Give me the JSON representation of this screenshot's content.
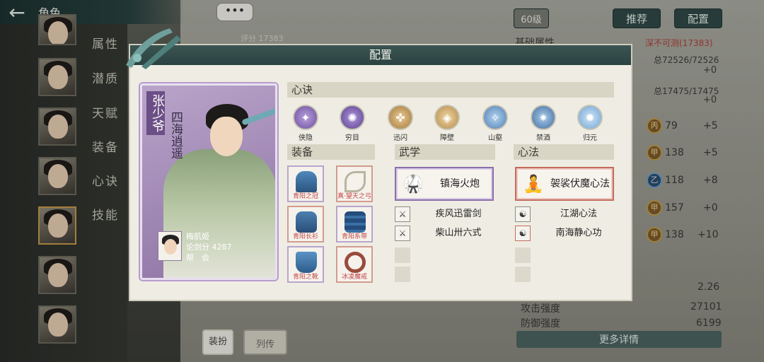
{
  "topbar": {
    "back_icon": "back-arrow-icon",
    "title": "角色"
  },
  "side_tabs": [
    "属性",
    "潜质",
    "天赋",
    "装备",
    "心诀",
    "技能"
  ],
  "top_right": {
    "level": "60级",
    "recommend": "推荐",
    "config": "配置"
  },
  "background": {
    "score": "评分 17383",
    "base_attr_label": "基础属性",
    "base_attr_value": "深不可测(17383)",
    "hp": "总72526/72526",
    "hp_plus": "+0",
    "mp": "总17475/17475",
    "mp_plus": "+0",
    "stats": [
      {
        "gem": "丙",
        "value": "79",
        "plus": "+5"
      },
      {
        "gem": "甲",
        "value": "138",
        "plus": "+5"
      },
      {
        "gem": "乙",
        "value": "118",
        "plus": "+8"
      },
      {
        "gem": "甲",
        "value": "157",
        "plus": "+0"
      },
      {
        "gem": "甲",
        "value": "138",
        "plus": "+10"
      }
    ],
    "misc_value": "2.26",
    "attack_label": "攻击强度",
    "attack_value": "27101",
    "defense_label": "防御强度",
    "defense_value": "6199",
    "more_details": "更多详情",
    "dress_label": "装扮",
    "bio_label": "列传"
  },
  "modal": {
    "title": "配置",
    "character": {
      "name": "张少爷",
      "title": "四海逍遥",
      "owner_name": "梅肌姬",
      "owner_score": "论剑分 4287",
      "owner_guild": "帮　会"
    },
    "sections": {
      "mind": "心诀",
      "equipment": "装备",
      "martial": "武学",
      "heart": "心法"
    },
    "mind_skills": [
      {
        "label": "侠隐",
        "color": "#8a6bb8"
      },
      {
        "label": "穷目",
        "color": "#7b5fb0"
      },
      {
        "label": "迅闪",
        "color": "#c79a4e"
      },
      {
        "label": "障壁",
        "color": "#caa868"
      },
      {
        "label": "山壑",
        "color": "#6f9fcf"
      },
      {
        "label": "禁酒",
        "color": "#5f8fc2"
      },
      {
        "label": "归元",
        "color": "#7fb3e0"
      }
    ],
    "equipment": [
      {
        "label": "青阳之冠",
        "color": "#3e6d9a",
        "rarity": "purple"
      },
      {
        "label": "真·望天之弓",
        "color": "#c9c3b0",
        "rarity": "red"
      },
      {
        "label": "青阳长衫",
        "color": "#3b6c99",
        "rarity": "red"
      },
      {
        "label": "青阳系带",
        "color": "#2f5c8c",
        "rarity": "purple"
      },
      {
        "label": "青阳之靴",
        "color": "#4d86b8",
        "rarity": "purple"
      },
      {
        "label": "冰凌魔戒",
        "color": "#8a4a3a",
        "rarity": "red"
      }
    ],
    "martial": {
      "main": "镇海火炮",
      "subs": [
        "疾风迅雷剑",
        "柴山卅六式"
      ]
    },
    "heart": {
      "main": "袈裟伏魔心法",
      "subs": [
        "江湖心法",
        "南海静心功"
      ]
    }
  }
}
